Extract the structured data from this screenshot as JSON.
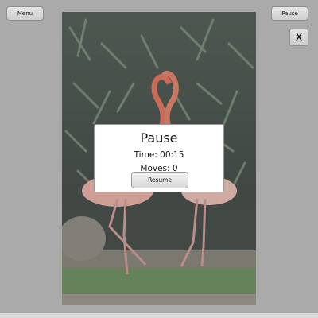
{
  "toolbar": {
    "menu_label": "Menu",
    "pause_label": "Pause",
    "close_label": "X"
  },
  "pause_dialog": {
    "title": "Pause",
    "time_label": "Time:",
    "time_value": "00:15",
    "moves_label": "Moves:",
    "moves_value": "0",
    "resume_label": "Resume"
  },
  "puzzle_image": {
    "subject": "flamingo-photo"
  }
}
